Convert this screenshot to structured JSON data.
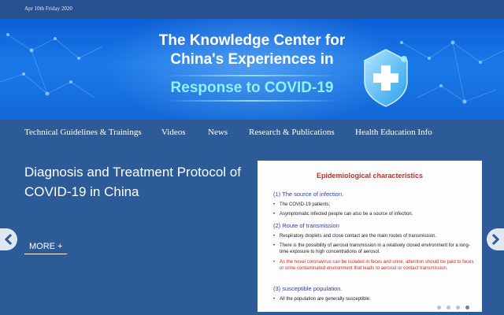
{
  "date": "Apr 10th Friday 2020",
  "banner": {
    "title_line1": "The Knowledge Center  for",
    "title_line2": "China's Experiences  in",
    "title_line3": "Response to COVID-19"
  },
  "nav": {
    "items": [
      {
        "label": "Technical Guidelines & Trainings"
      },
      {
        "label": "Videos"
      },
      {
        "label": "News"
      },
      {
        "label": "Research & Publications"
      },
      {
        "label": "Health Education Info"
      }
    ]
  },
  "slide": {
    "title": "Diagnosis and Treatment Protocol of COVID-19 in China",
    "more_label": "MORE +"
  },
  "card": {
    "title": "Epidemiological characteristics",
    "head1": "(1) The source of infection.",
    "b1": "The COVID-19 patients;",
    "b2": "Asymptomatic infected people can also be a source of infection.",
    "head2": "(2) Route of transmission",
    "b3": "Respiratory droplets and close contact are the main routes of transmission.",
    "b4": "There is the possibility of aerosol transmission in a relatively closed environment for a long-time exposure to high concentrations of aerosol.",
    "b5": "As the novel coronavirus can be isolated in feces and urine, attention should be paid to feces or urine contaminated environment that leads to aerosol or contact transmission.",
    "head3": "(3) susceptible population.",
    "b6": "All the population are generally susceptible.",
    "bullet": "•"
  },
  "colors": {
    "nav_bg": "#2c5b97",
    "banner_blue": "#1a79e8",
    "highlight_cyan": "#8ff2ff",
    "card_title_red": "#d9261c",
    "card_head_blue": "#2a3fb0"
  },
  "icons": {
    "left_arrow": "chevron-left-icon",
    "right_arrow": "chevron-right-icon",
    "emblem": "medical-shield-icon"
  },
  "carousel": {
    "dot_count": 4,
    "active_index": 3
  }
}
